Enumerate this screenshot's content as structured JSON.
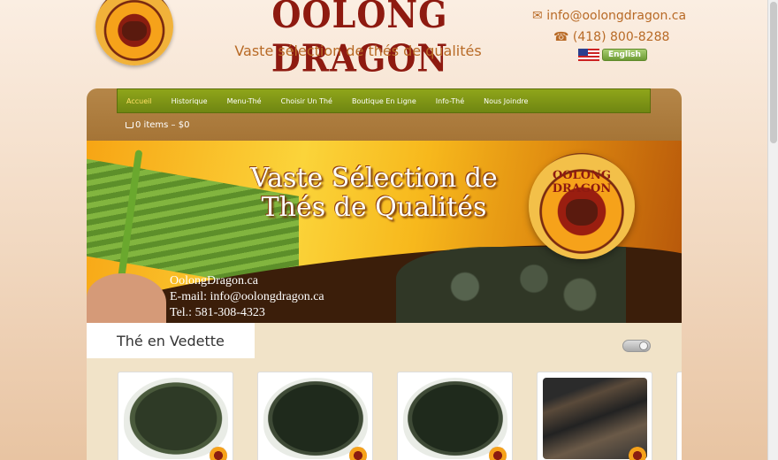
{
  "header": {
    "brand": "OOLONG DRAGON",
    "tagline": "Vaste sélection de thés de qualités",
    "email": "info@oolongdragon.ca",
    "phone": "(418) 800-8288",
    "language_button": "English"
  },
  "nav": {
    "items": [
      {
        "label": "Accueil",
        "active": true
      },
      {
        "label": "Historique"
      },
      {
        "label": "Menu-Thé"
      },
      {
        "label": "Choisir Un Thé"
      },
      {
        "label": "Boutique En Ligne"
      },
      {
        "label": "Info-Thé"
      },
      {
        "label": "Nous Joindre"
      }
    ]
  },
  "cart": {
    "label": "0 items – $0"
  },
  "banner": {
    "title_line1": "Vaste Sélection de",
    "title_line2": "Thés de Qualités",
    "logo_text": "OOLONG DRAGON",
    "site": "OolongDragon.ca",
    "email": "E-mail: info@oolongdragon.ca",
    "phone": "Tel.: 581-308-4323"
  },
  "featured": {
    "title": "Thé en Vedette"
  },
  "colors": {
    "accent": "#b86a26",
    "brand": "#8e1a10",
    "nav": "#7f961a"
  },
  "icons": [
    "envelope-icon",
    "phone-icon",
    "us-flag-icon",
    "cart-icon",
    "toggle-icon"
  ]
}
